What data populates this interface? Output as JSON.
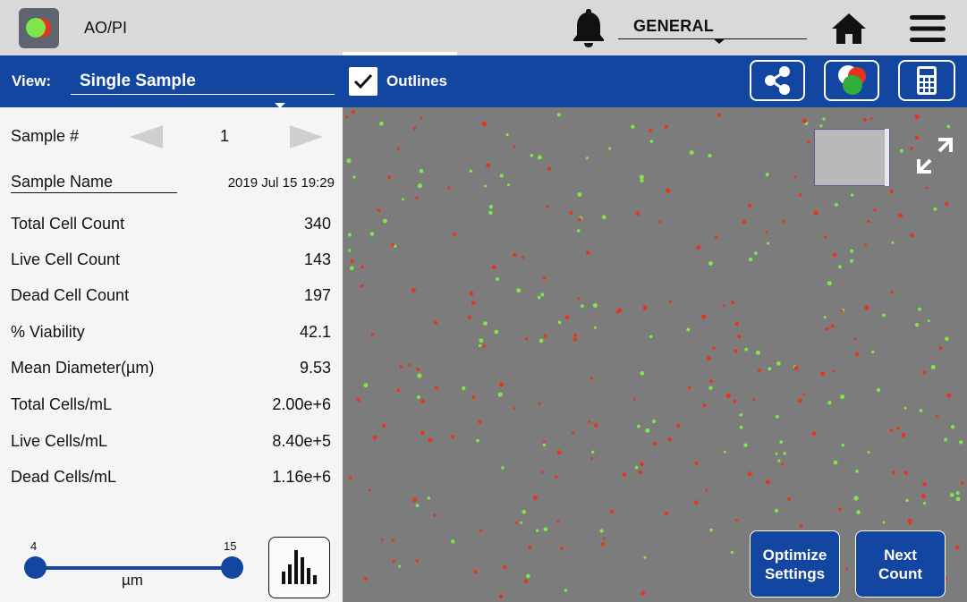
{
  "app": {
    "title": "AO/PI",
    "icon": "ao-pi-app-icon",
    "profile": "GENERAL"
  },
  "toolbar": {
    "view_label": "View:",
    "view_value": "Single Sample",
    "outlines_label": "Outlines",
    "outlines_checked": true,
    "icons": [
      "share-icon",
      "color-channels-icon",
      "calculator-icon"
    ]
  },
  "sample": {
    "number_label": "Sample #",
    "number": "1",
    "name_label": "Sample Name",
    "date": "2019 Jul 15 19:29"
  },
  "results": [
    {
      "label": "Total Cell Count",
      "value": "340"
    },
    {
      "label": "Live Cell Count",
      "value": "143"
    },
    {
      "label": "Dead Cell Count",
      "value": "197"
    },
    {
      "label": "% Viability",
      "value": "42.1"
    },
    {
      "label": "Mean Diameter(µm)",
      "value": "9.53"
    },
    {
      "label": "Total Cells/mL",
      "value": "2.00e+6"
    },
    {
      "label": "Live Cells/mL",
      "value": "8.40e+5"
    },
    {
      "label": "Dead Cells/mL",
      "value": "1.16e+6"
    }
  ],
  "size_filter": {
    "min": "4",
    "max": "15",
    "unit": "µm"
  },
  "actions": {
    "optimize": "Optimize Settings",
    "next": "Next Count"
  },
  "colors": {
    "primary": "#1346a0",
    "live_cell": "#7de64a",
    "dead_cell": "#e8341c",
    "image_bg": "#7c7c7c"
  }
}
